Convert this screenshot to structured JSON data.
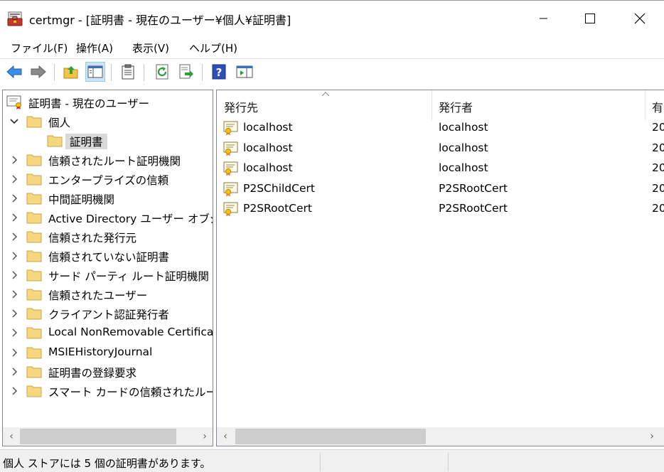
{
  "window": {
    "title": "certmgr - [証明書 - 現在のユーザー¥個人¥証明書]"
  },
  "menu": [
    "ファイル(F)",
    "操作(A)",
    "表示(V)",
    "ヘルプ(H)"
  ],
  "toolbar": {
    "buttons": [
      "back-icon",
      "forward-icon",
      "up-folder-icon",
      "show-hide-tree-icon",
      "properties-icon",
      "refresh-icon",
      "export-list-icon",
      "help-icon",
      "show-action-pane-icon"
    ]
  },
  "tree": {
    "root": "証明書 - 現在のユーザー",
    "personal": "個人",
    "personal_child": "証明書",
    "items": [
      "信頼されたルート証明機関",
      "エンタープライズの信頼",
      "中間証明機関",
      "Active Directory ユーザー オブジェ",
      "信頼された発行元",
      "信頼されていない証明書",
      "サード パーティ ルート証明機関",
      "信頼されたユーザー",
      "クライアント認証発行者",
      "Local NonRemovable Certifica",
      "MSIEHistoryJournal",
      "証明書の登録要求",
      "スマート カードの信頼されたルート"
    ]
  },
  "list": {
    "columns": [
      "発行先",
      "発行者",
      "有"
    ],
    "rows": [
      {
        "issued_to": "localhost",
        "issued_by": "localhost",
        "expires": "20"
      },
      {
        "issued_to": "localhost",
        "issued_by": "localhost",
        "expires": "20"
      },
      {
        "issued_to": "localhost",
        "issued_by": "localhost",
        "expires": "20"
      },
      {
        "issued_to": "P2SChildCert",
        "issued_by": "P2SRootCert",
        "expires": "20"
      },
      {
        "issued_to": "P2SRootCert",
        "issued_by": "P2SRootCert",
        "expires": "20"
      }
    ]
  },
  "status": {
    "text": "個人 ストアには 5 個の証明書があります。"
  },
  "colors": {
    "selection": "#d9d9d9",
    "folder": "#f5d77e",
    "toolbar_pressed": "#cce4f7"
  }
}
